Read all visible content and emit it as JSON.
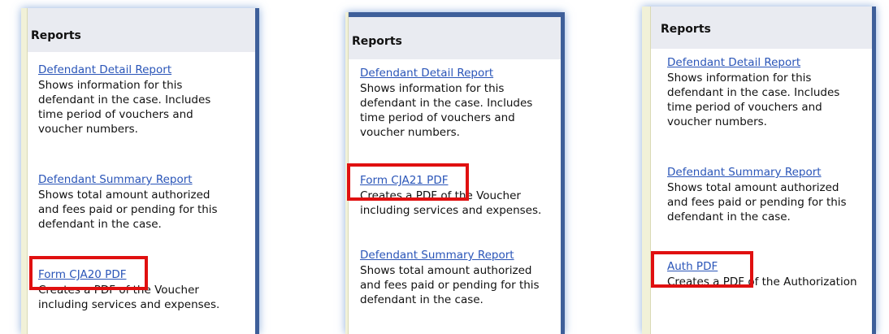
{
  "panels": [
    {
      "title": "Reports",
      "items": [
        {
          "label": "Defendant Detail Report",
          "desc": "Shows information for this defendant in the case. Includes time period of vouchers and voucher numbers."
        },
        {
          "label": "Defendant Summary Report",
          "desc": "Shows total amount authorized and fees paid or pending for this defendant in the case."
        },
        {
          "label": "Form CJA20 PDF",
          "desc": "Creates a PDF of the Voucher including services and expenses."
        }
      ]
    },
    {
      "title": "Reports",
      "items": [
        {
          "label": "Defendant Detail Report",
          "desc": "Shows information for this defendant in the case. Includes time period of vouchers and voucher numbers."
        },
        {
          "label": "Form CJA21 PDF",
          "desc": "Creates a PDF of the Voucher including services and expenses."
        },
        {
          "label": "Defendant Summary Report",
          "desc": "Shows total amount authorized and fees paid or pending for this defendant in the case."
        }
      ]
    },
    {
      "title": "Reports",
      "items": [
        {
          "label": "Defendant Detail Report",
          "desc": "Shows information for this defendant in the case. Includes time period of vouchers and voucher numbers."
        },
        {
          "label": "Defendant Summary Report",
          "desc": "Shows total amount authorized and fees paid or pending for this defendant in the case."
        },
        {
          "label": "Auth PDF",
          "desc": "Creates a PDF of the Authorization"
        }
      ]
    }
  ],
  "colors": {
    "link": "#2a55b8",
    "highlight": "#e01010",
    "border": "#3e5f9a",
    "header_bg": "#e9ebf1"
  }
}
